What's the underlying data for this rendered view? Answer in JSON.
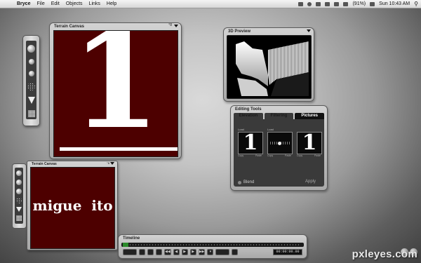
{
  "menubar": {
    "apple": "",
    "items": [
      "Bryce",
      "File",
      "Edit",
      "Objects",
      "Links",
      "Help"
    ],
    "battery": "(91%)",
    "clock": "Sun 10:43 AM"
  },
  "terrain_canvas_big": {
    "title": "Terrain Canvas",
    "extra": "°8",
    "glyph": "1"
  },
  "terrain_canvas_small": {
    "title": "Terrain Canvas",
    "extra": "°8",
    "text": "migue  ito"
  },
  "preview": {
    "title": "3D Preview"
  },
  "editing_tools": {
    "title": "Editing Tools",
    "tabs": [
      "Elevation",
      "Filtering",
      "Pictures"
    ],
    "active_tab": "Pictures",
    "cells": [
      {
        "label": "Load",
        "glyph": "1",
        "left": "Copy",
        "right": "Paste"
      },
      {
        "label": "Load",
        "glyph": "",
        "left": "Copy",
        "right": "Paste"
      },
      {
        "label": "",
        "glyph": "1",
        "left": "Copy",
        "right": "Paste"
      }
    ],
    "blend_label": "Blend",
    "apply_label": "Apply"
  },
  "timeline": {
    "title": "Timeline",
    "time": "00:00:00.00"
  },
  "watermark": "pxleyes.com",
  "colors": {
    "canvas": "#4d0000",
    "playhead": "#2a8a2a"
  }
}
